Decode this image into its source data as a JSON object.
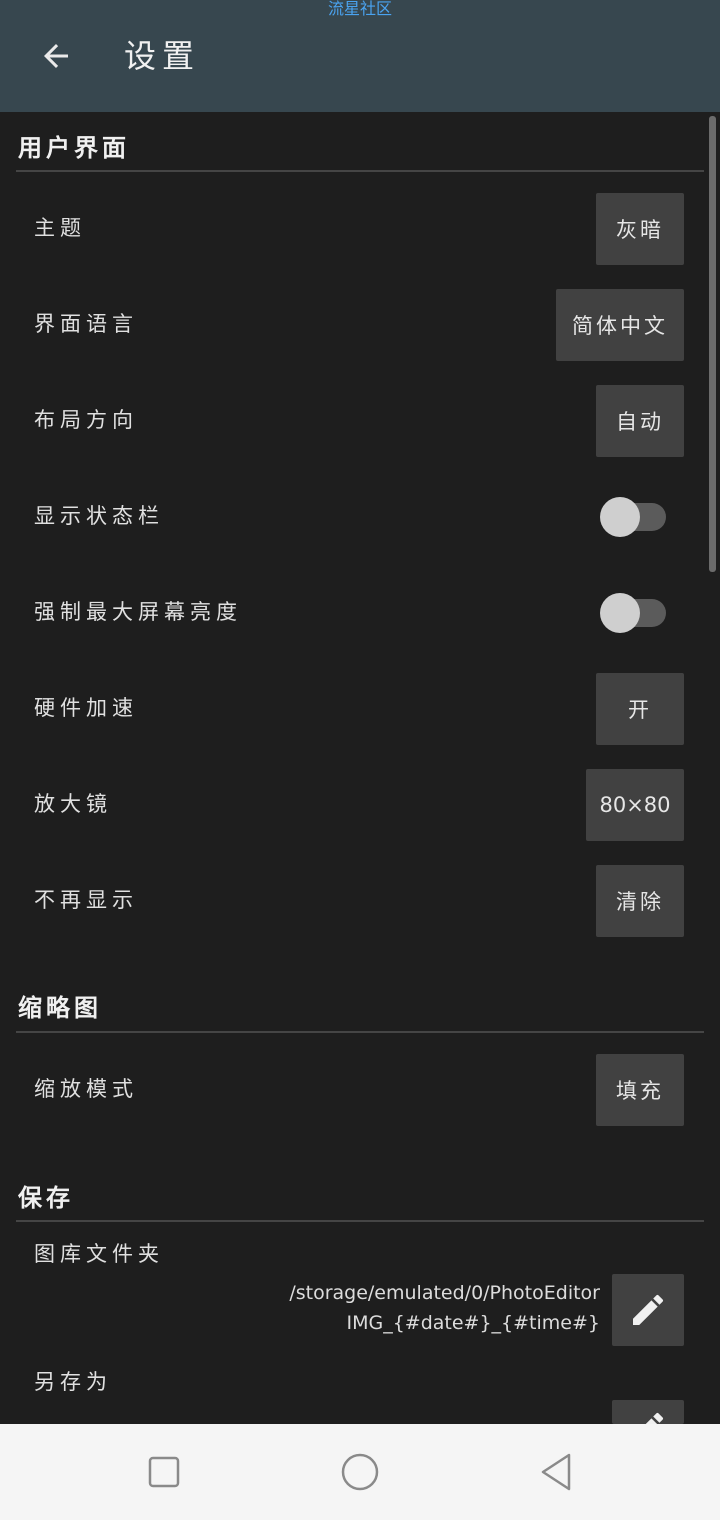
{
  "status": {
    "watermark": "流星社区"
  },
  "appbar": {
    "title": "设置",
    "back_icon": "arrow-back-icon"
  },
  "sections": {
    "ui": {
      "title": "用户界面",
      "theme": {
        "label": "主题",
        "value": "灰暗"
      },
      "language": {
        "label": "界面语言",
        "value": "简体中文"
      },
      "layout": {
        "label": "布局方向",
        "value": "自动"
      },
      "statusbar": {
        "label": "显示状态栏",
        "enabled": false
      },
      "brightness": {
        "label": "强制最大屏幕亮度",
        "enabled": false
      },
      "hwaccel": {
        "label": "硬件加速",
        "value": "开"
      },
      "magnifier": {
        "label": "放大镜",
        "value": "80×80"
      },
      "dontshow": {
        "label": "不再显示",
        "value": "清除"
      }
    },
    "thumb": {
      "title": "缩略图",
      "scale": {
        "label": "缩放模式",
        "value": "填充"
      }
    },
    "save": {
      "title": "保存",
      "gallery": {
        "label": "图库文件夹",
        "path": "/storage/emulated/0/PhotoEditor",
        "filename": "IMG_{#date#}_{#time#}",
        "edit_icon": "pencil-icon"
      },
      "saveas": {
        "label": "另存为"
      }
    }
  },
  "navbar": {
    "recent_icon": "square-recents-icon",
    "home_icon": "circle-home-icon",
    "back_icon": "triangle-back-icon"
  },
  "colors": {
    "appbar": "#37474f",
    "background": "#1e1e1e",
    "button": "#414141",
    "watermark": "#4aa3f0"
  }
}
